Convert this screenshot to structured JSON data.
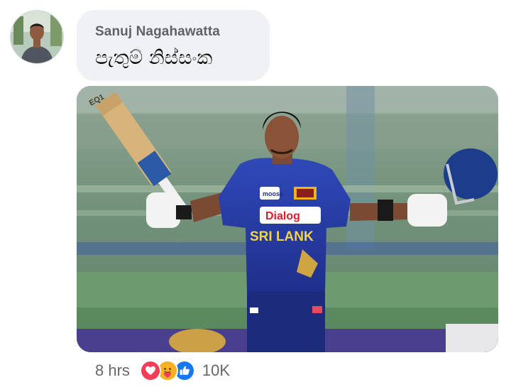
{
  "comment": {
    "author": "Sanuj Nagahawatta",
    "text": "පැතුම් නිස්සංක",
    "avatar_icon": "user-avatar",
    "photo": {
      "jersey_text_sponsor": "Dialog",
      "jersey_text_team": "SRI LANK",
      "jersey_text_brand": "moose",
      "bat_text": "EQ1"
    }
  },
  "footer": {
    "time": "8 hrs",
    "reaction_count": "10K",
    "reactions": [
      "love-icon",
      "care-icon",
      "like-icon"
    ]
  },
  "colors": {
    "bubble_bg": "#eff1f4",
    "like_blue": "#1877f2",
    "love_red": "#f33e58",
    "care_yellow": "#f7b125",
    "meta_grey": "#65676b"
  }
}
